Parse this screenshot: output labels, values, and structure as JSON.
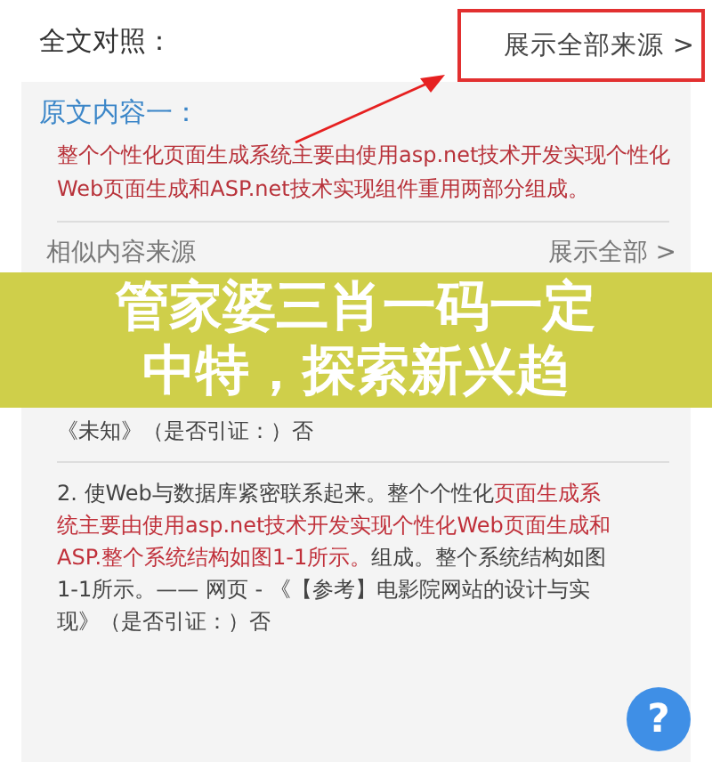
{
  "header": {
    "title": "全文对照：",
    "link": "展示全部来源 >"
  },
  "original": {
    "title": "原文内容一：",
    "text": "整个个性化页面生成系统主要由使用asp.net技术开发实现个性化Web页面生成和ASP.net技术实现组件重用两部分组成。"
  },
  "similar": {
    "title": "相似内容来源",
    "link": "展示全部 >",
    "items": [
      {
        "segments": [
          {
            "text": "《未知》（是否引证：）否",
            "highlight": false
          }
        ]
      },
      {
        "segments": [
          {
            "text": "2. 使Web与数据库紧密联系起来。整个个性化",
            "highlight": false
          },
          {
            "text": "页面生成系统主要由使用asp.net技术开发实现个性化Web页面生成和ASP.整个系统结构如图1-1所示。",
            "highlight": true
          },
          {
            "text": "组成。整个系统结构如图1-1所示。—— 网页 - 《【参考】电影院网站的设计与实现》（是否引证：）否",
            "highlight": false
          }
        ]
      }
    ]
  },
  "banner": {
    "text": "管家婆三肖一码一定中特，探索新兴趋"
  },
  "help_button": {
    "label": "?"
  }
}
